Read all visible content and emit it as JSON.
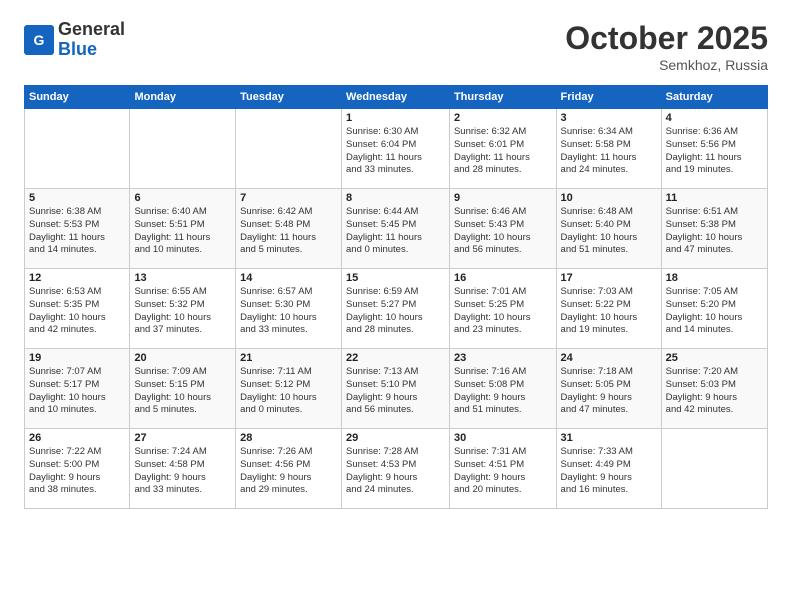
{
  "header": {
    "logo": {
      "general": "General",
      "blue": "Blue"
    },
    "title": "October 2025",
    "subtitle": "Semkhoz, Russia"
  },
  "weekdays": [
    "Sunday",
    "Monday",
    "Tuesday",
    "Wednesday",
    "Thursday",
    "Friday",
    "Saturday"
  ],
  "weeks": [
    [
      {
        "day": "",
        "info": ""
      },
      {
        "day": "",
        "info": ""
      },
      {
        "day": "",
        "info": ""
      },
      {
        "day": "1",
        "info": "Sunrise: 6:30 AM\nSunset: 6:04 PM\nDaylight: 11 hours\nand 33 minutes."
      },
      {
        "day": "2",
        "info": "Sunrise: 6:32 AM\nSunset: 6:01 PM\nDaylight: 11 hours\nand 28 minutes."
      },
      {
        "day": "3",
        "info": "Sunrise: 6:34 AM\nSunset: 5:58 PM\nDaylight: 11 hours\nand 24 minutes."
      },
      {
        "day": "4",
        "info": "Sunrise: 6:36 AM\nSunset: 5:56 PM\nDaylight: 11 hours\nand 19 minutes."
      }
    ],
    [
      {
        "day": "5",
        "info": "Sunrise: 6:38 AM\nSunset: 5:53 PM\nDaylight: 11 hours\nand 14 minutes."
      },
      {
        "day": "6",
        "info": "Sunrise: 6:40 AM\nSunset: 5:51 PM\nDaylight: 11 hours\nand 10 minutes."
      },
      {
        "day": "7",
        "info": "Sunrise: 6:42 AM\nSunset: 5:48 PM\nDaylight: 11 hours\nand 5 minutes."
      },
      {
        "day": "8",
        "info": "Sunrise: 6:44 AM\nSunset: 5:45 PM\nDaylight: 11 hours\nand 0 minutes."
      },
      {
        "day": "9",
        "info": "Sunrise: 6:46 AM\nSunset: 5:43 PM\nDaylight: 10 hours\nand 56 minutes."
      },
      {
        "day": "10",
        "info": "Sunrise: 6:48 AM\nSunset: 5:40 PM\nDaylight: 10 hours\nand 51 minutes."
      },
      {
        "day": "11",
        "info": "Sunrise: 6:51 AM\nSunset: 5:38 PM\nDaylight: 10 hours\nand 47 minutes."
      }
    ],
    [
      {
        "day": "12",
        "info": "Sunrise: 6:53 AM\nSunset: 5:35 PM\nDaylight: 10 hours\nand 42 minutes."
      },
      {
        "day": "13",
        "info": "Sunrise: 6:55 AM\nSunset: 5:32 PM\nDaylight: 10 hours\nand 37 minutes."
      },
      {
        "day": "14",
        "info": "Sunrise: 6:57 AM\nSunset: 5:30 PM\nDaylight: 10 hours\nand 33 minutes."
      },
      {
        "day": "15",
        "info": "Sunrise: 6:59 AM\nSunset: 5:27 PM\nDaylight: 10 hours\nand 28 minutes."
      },
      {
        "day": "16",
        "info": "Sunrise: 7:01 AM\nSunset: 5:25 PM\nDaylight: 10 hours\nand 23 minutes."
      },
      {
        "day": "17",
        "info": "Sunrise: 7:03 AM\nSunset: 5:22 PM\nDaylight: 10 hours\nand 19 minutes."
      },
      {
        "day": "18",
        "info": "Sunrise: 7:05 AM\nSunset: 5:20 PM\nDaylight: 10 hours\nand 14 minutes."
      }
    ],
    [
      {
        "day": "19",
        "info": "Sunrise: 7:07 AM\nSunset: 5:17 PM\nDaylight: 10 hours\nand 10 minutes."
      },
      {
        "day": "20",
        "info": "Sunrise: 7:09 AM\nSunset: 5:15 PM\nDaylight: 10 hours\nand 5 minutes."
      },
      {
        "day": "21",
        "info": "Sunrise: 7:11 AM\nSunset: 5:12 PM\nDaylight: 10 hours\nand 0 minutes."
      },
      {
        "day": "22",
        "info": "Sunrise: 7:13 AM\nSunset: 5:10 PM\nDaylight: 9 hours\nand 56 minutes."
      },
      {
        "day": "23",
        "info": "Sunrise: 7:16 AM\nSunset: 5:08 PM\nDaylight: 9 hours\nand 51 minutes."
      },
      {
        "day": "24",
        "info": "Sunrise: 7:18 AM\nSunset: 5:05 PM\nDaylight: 9 hours\nand 47 minutes."
      },
      {
        "day": "25",
        "info": "Sunrise: 7:20 AM\nSunset: 5:03 PM\nDaylight: 9 hours\nand 42 minutes."
      }
    ],
    [
      {
        "day": "26",
        "info": "Sunrise: 7:22 AM\nSunset: 5:00 PM\nDaylight: 9 hours\nand 38 minutes."
      },
      {
        "day": "27",
        "info": "Sunrise: 7:24 AM\nSunset: 4:58 PM\nDaylight: 9 hours\nand 33 minutes."
      },
      {
        "day": "28",
        "info": "Sunrise: 7:26 AM\nSunset: 4:56 PM\nDaylight: 9 hours\nand 29 minutes."
      },
      {
        "day": "29",
        "info": "Sunrise: 7:28 AM\nSunset: 4:53 PM\nDaylight: 9 hours\nand 24 minutes."
      },
      {
        "day": "30",
        "info": "Sunrise: 7:31 AM\nSunset: 4:51 PM\nDaylight: 9 hours\nand 20 minutes."
      },
      {
        "day": "31",
        "info": "Sunrise: 7:33 AM\nSunset: 4:49 PM\nDaylight: 9 hours\nand 16 minutes."
      },
      {
        "day": "",
        "info": ""
      }
    ]
  ]
}
